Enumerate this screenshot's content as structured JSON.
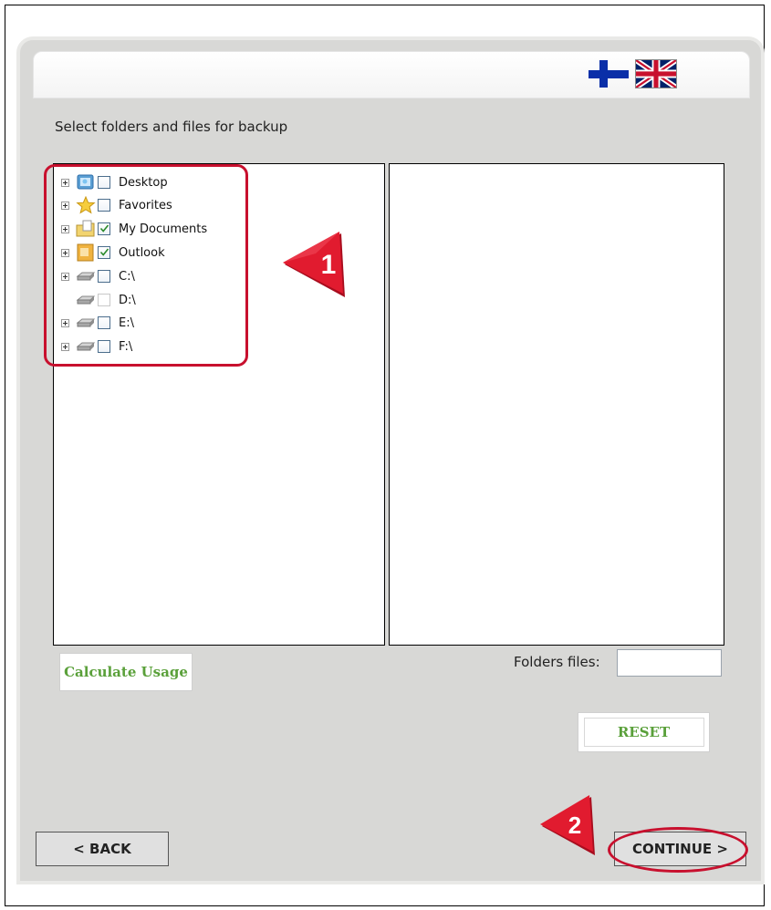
{
  "header": {
    "languages": [
      {
        "name": "Finnish",
        "icon": "finland-flag-icon"
      },
      {
        "name": "English",
        "icon": "uk-flag-icon"
      }
    ]
  },
  "prompt": "Select folders and files for backup",
  "tree": {
    "items": [
      {
        "label": "Desktop",
        "icon": "desktop-icon",
        "expandable": true,
        "checked": false
      },
      {
        "label": "Favorites",
        "icon": "favorites-star-icon",
        "expandable": true,
        "checked": false
      },
      {
        "label": "My Documents",
        "icon": "documents-folder-icon",
        "expandable": true,
        "checked": true
      },
      {
        "label": "Outlook",
        "icon": "outlook-icon",
        "expandable": true,
        "checked": true
      },
      {
        "label": "C:\\",
        "icon": "drive-icon",
        "expandable": true,
        "checked": false
      },
      {
        "label": "D:\\",
        "icon": "drive-icon",
        "expandable": false,
        "checked": false
      },
      {
        "label": "E:\\",
        "icon": "drive-icon",
        "expandable": true,
        "checked": false
      },
      {
        "label": "F:\\",
        "icon": "drive-icon",
        "expandable": true,
        "checked": false
      }
    ]
  },
  "annotations": {
    "step1": "1",
    "step2": "2",
    "accent_color": "#c8102e"
  },
  "buttons": {
    "calculate": "Calculate Usage",
    "reset": "RESET",
    "back": "< BACK",
    "continue": "CONTINUE >"
  },
  "folders_files": {
    "label": "Folders files:",
    "value": ""
  },
  "colors": {
    "button_text_green": "#5aa03a",
    "panel_bg": "#d8d8d6"
  }
}
